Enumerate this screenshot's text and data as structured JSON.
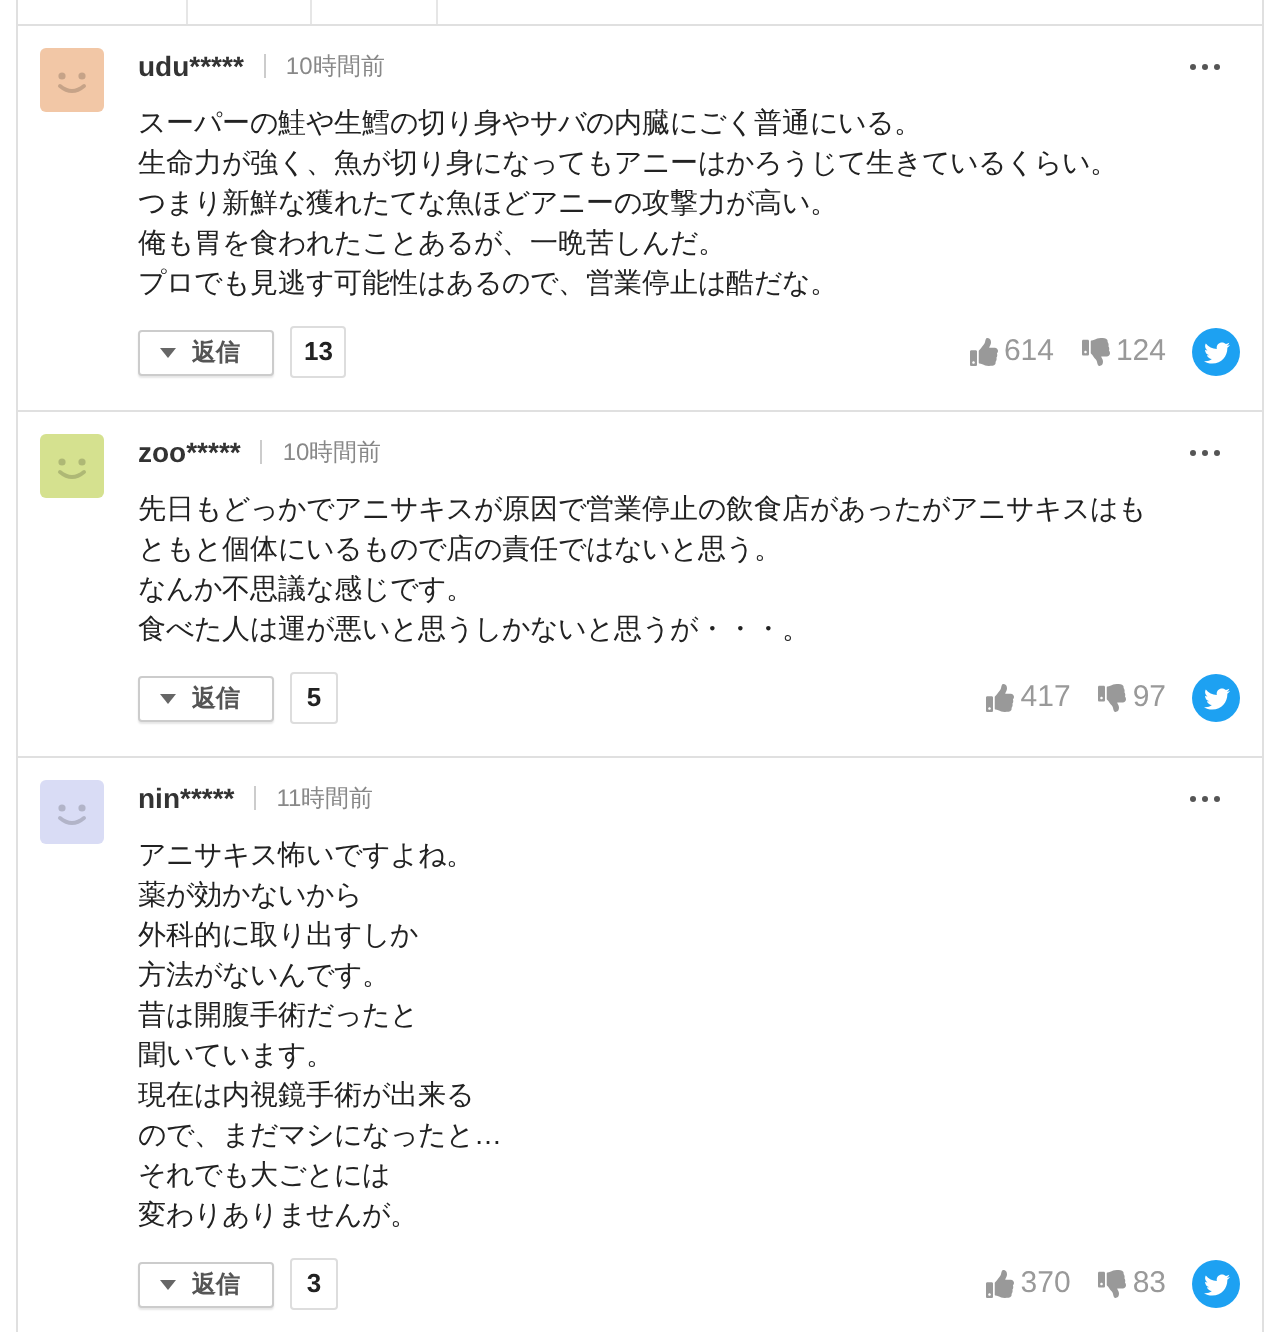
{
  "comments": [
    {
      "user": "udu*****",
      "time": "10時間前",
      "color": "#f2c7a6",
      "lines": [
        "スーパーの鮭や生鱈の切り身やサバの内臓にごく普通にいる。",
        "生命力が強く、魚が切り身になってもアニーはかろうじて生きているくらい。",
        "つまり新鮮な獲れたてな魚ほどアニーの攻撃力が高い。",
        "俺も胃を食われたことあるが、一晩苦しんだ。",
        "プロでも見逃す可能性はあるので、営業停止は酷だな。"
      ],
      "reply_label": "返信",
      "reply_count": "13",
      "likes": "614",
      "dislikes": "124"
    },
    {
      "user": "zoo*****",
      "time": "10時間前",
      "color": "#d5e18f",
      "lines": [
        "先日もどっかでアニサキスが原因で営業停止の飲食店があったがアニサキスはも",
        "ともと個体にいるもので店の責任ではないと思う。",
        "なんか不思議な感じです。",
        "食べた人は運が悪いと思うしかないと思うが・・・。"
      ],
      "reply_label": "返信",
      "reply_count": "5",
      "likes": "417",
      "dislikes": "97"
    },
    {
      "user": "nin*****",
      "time": "11時間前",
      "color": "#d9dcf5",
      "lines": [
        "アニサキス怖いですよね。",
        "薬が効かないから",
        "外科的に取り出すしか",
        "方法がないんです。",
        "昔は開腹手術だったと",
        "聞いています。",
        "現在は内視鏡手術が出来る",
        "ので、まだマシになったと…",
        "それでも大ごとには",
        "変わりありませんが。"
      ],
      "reply_label": "返信",
      "reply_count": "3",
      "likes": "370",
      "dislikes": "83"
    }
  ]
}
